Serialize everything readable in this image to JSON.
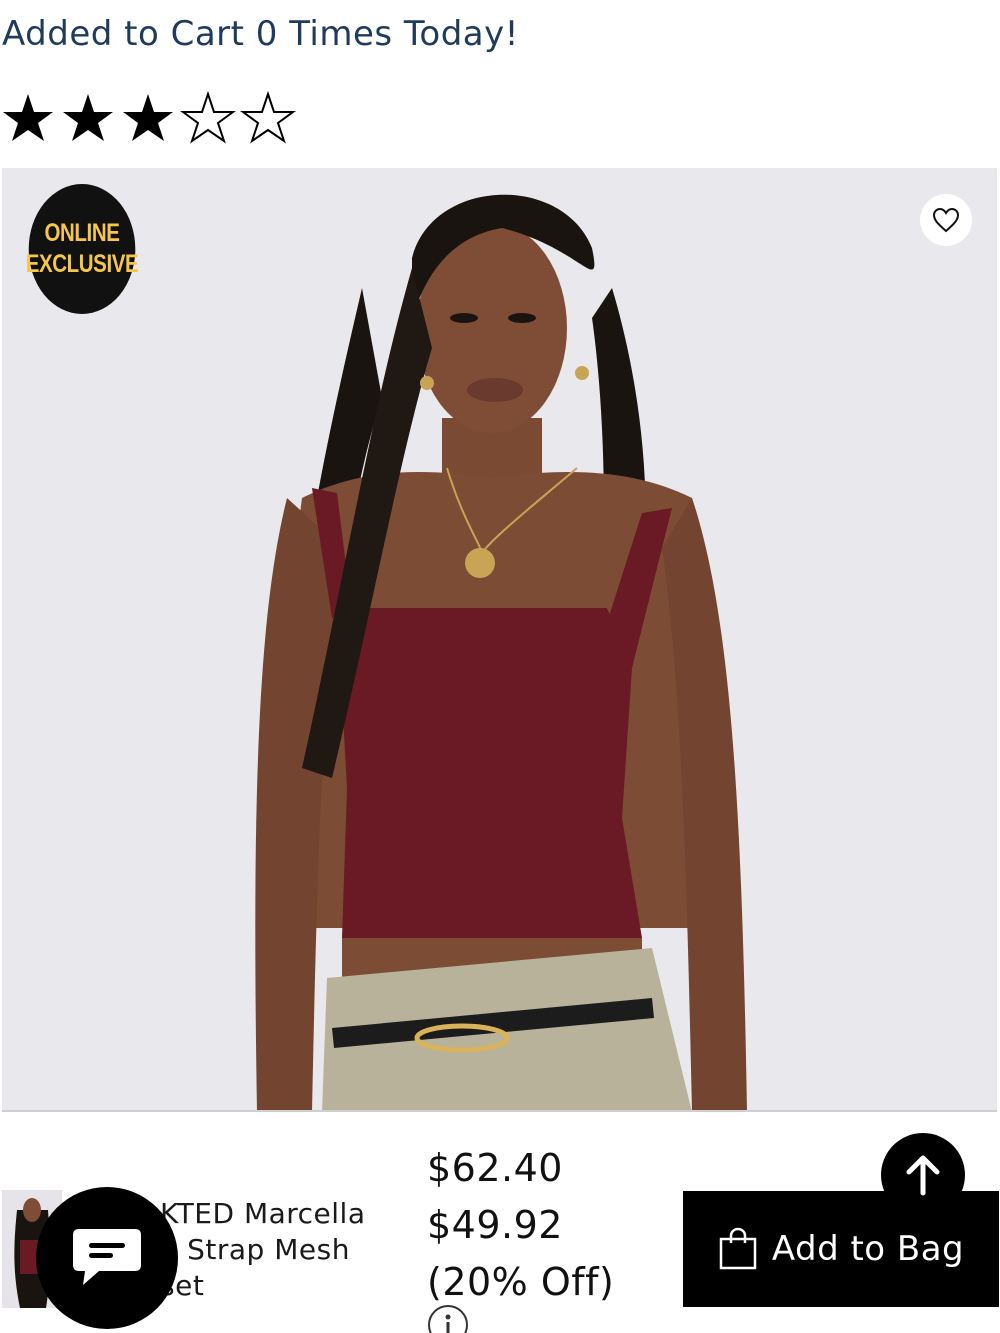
{
  "cart_notice": "Added to Cart 0 Times Today!",
  "rating": {
    "value": 3,
    "max": 5,
    "icon": "star-icon"
  },
  "product_image": {
    "badge_line1": "ONLINE",
    "badge_line2": "EXCLUSIVE",
    "wishlist_icon": "heart-outline-icon"
  },
  "bottom_bar": {
    "product_name_lines": [
      "KTED Marcella",
      "e Strap Mesh",
      "set"
    ],
    "price_original": "$62.40",
    "price_sale": "$49.92",
    "discount": "(20% Off)",
    "info_icon": "info-icon",
    "add_to_bag_label": "Add to Bag",
    "bag_icon": "shopping-bag-icon",
    "scroll_top_icon": "arrow-up-icon",
    "chat_icon": "chat-bubble-icon"
  },
  "colors": {
    "notice_text": "#1f3a5a",
    "badge_text": "#f5c64a",
    "button_bg": "#000000",
    "top_color": "#6a1a24"
  }
}
